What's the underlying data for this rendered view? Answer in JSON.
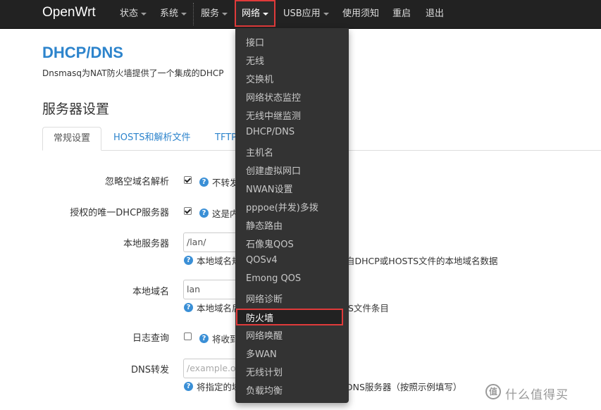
{
  "navbar": {
    "brand": "OpenWrt",
    "items": [
      {
        "label": "状态",
        "has_caret": true
      },
      {
        "label": "系统",
        "has_caret": true
      },
      {
        "label": "服务",
        "has_caret": true
      },
      {
        "label": "网络",
        "has_caret": true,
        "active": true
      },
      {
        "label": "USB应用",
        "has_caret": true
      },
      {
        "label": "使用须知",
        "has_caret": false
      },
      {
        "label": "重启",
        "has_caret": false
      },
      {
        "label": "退出",
        "has_caret": false
      }
    ]
  },
  "network_menu": {
    "items": [
      "接口",
      "无线",
      "交换机",
      "网络状态监控",
      "无线中继监测",
      "DHCP/DNS",
      "主机名",
      "创建虚拟网口",
      "NWAN设置",
      "pppoe(并发)多拨",
      "静态路由",
      "石像鬼QOS",
      "QOSv4",
      "Emong QOS",
      "网络诊断",
      "防火墙",
      "网络唤醒",
      "多WAN",
      "无线计划",
      "负载均衡"
    ],
    "highlighted": "防火墙"
  },
  "page": {
    "title": "DHCP/DNS",
    "description": "Dnsmasq为NAT防火墙提供了一个集成的DHCP"
  },
  "section": {
    "title": "服务器设置"
  },
  "tabs": [
    {
      "label": "常规设置",
      "active": true
    },
    {
      "label": "HOSTS和解析文件",
      "active": false
    },
    {
      "label": "TFTP",
      "active": false
    }
  ],
  "fields": {
    "ignore_empty_domain": {
      "label": "忽略空域名解析",
      "checked": true,
      "help": "不转发"
    },
    "authoritative": {
      "label": "授权的唯一DHCP服务器",
      "checked": true,
      "help": "这是内"
    },
    "local_server": {
      "label": "本地服务器",
      "value": "/lan/",
      "help_left": "本地域名规",
      "help_right": "自DHCP或HOSTS文件的本地域名数据"
    },
    "local_domain": {
      "label": "本地域名",
      "value": "lan",
      "help_left": "本地域名后",
      "help_right": "S文件条目"
    },
    "log_queries": {
      "label": "日志查询",
      "checked": false,
      "help": "将收到"
    },
    "dns_forwarding": {
      "label": "DNS转发",
      "placeholder": "/example.org",
      "help_left": "将指定的域",
      "help_right": "DNS服务器（按照示例填写）"
    }
  },
  "watermark": {
    "logo": "值",
    "text": "什么值得买"
  },
  "colors": {
    "navbar_bg": "#222222",
    "dropdown_bg": "#333333",
    "accent_blue": "#2d84cc",
    "highlight_red": "#e03a3a"
  }
}
